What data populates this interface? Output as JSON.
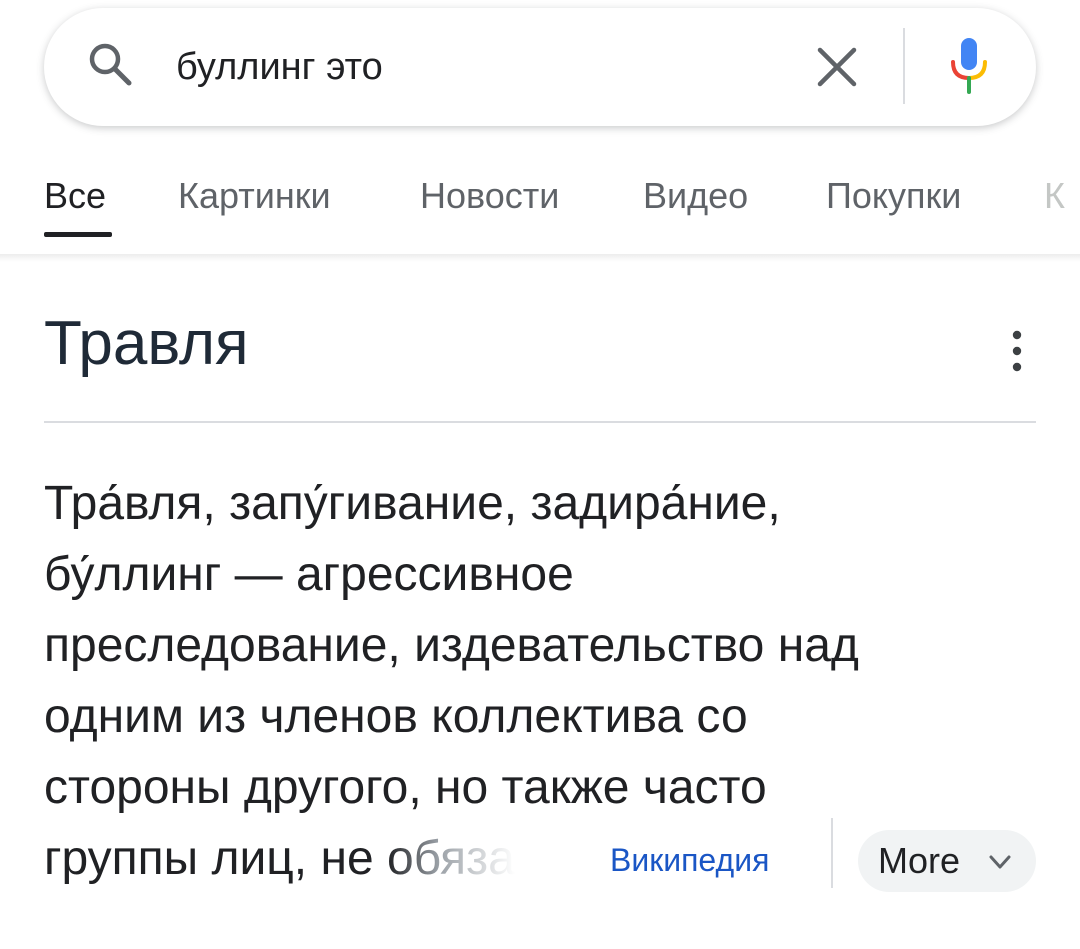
{
  "search": {
    "query": "буллинг это"
  },
  "tabs": [
    {
      "label": "Все",
      "active": true
    },
    {
      "label": "Картинки",
      "active": false
    },
    {
      "label": "Новости",
      "active": false
    },
    {
      "label": "Видео",
      "active": false
    },
    {
      "label": "Покупки",
      "active": false
    },
    {
      "label": "К",
      "active": false
    }
  ],
  "panel": {
    "title": "Травля",
    "description_lines": [
      "Тра́вля, запу́гивание, задира́ние,",
      "бу́ллинг — агрессивное",
      "преследование, издевательство над",
      "одним из членов коллектива со",
      "стороны другого, но также часто"
    ],
    "description_last_visible": "группы лиц, не ",
    "description_last_faded": "обяза",
    "source_label": "Википедия",
    "more_label": "More"
  },
  "icons": {
    "search": "search-icon",
    "clear": "close-icon",
    "mic": "microphone-icon",
    "menu": "more-vert-icon",
    "chevron": "chevron-down-icon"
  },
  "colors": {
    "link": "#1a56c5",
    "text": "#202124",
    "muted": "#5f6368",
    "mic_blue": "#4285f4",
    "mic_red": "#ea4335",
    "mic_yellow": "#fbbc04",
    "mic_green": "#34a853"
  }
}
